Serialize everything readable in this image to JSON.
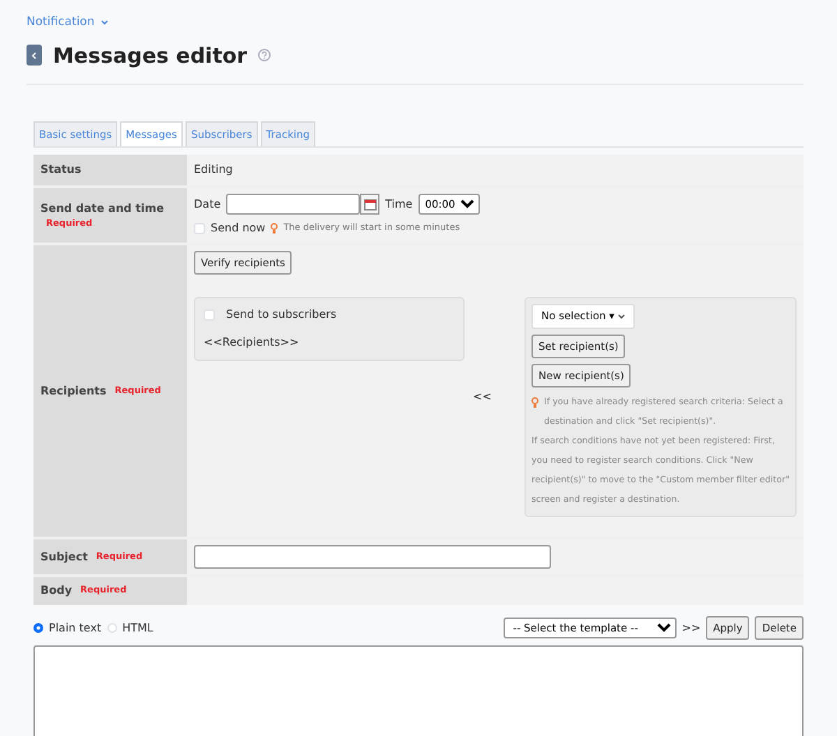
{
  "breadcrumb": {
    "label": "Notification"
  },
  "page_title": "Messages editor",
  "tabs": [
    {
      "label": "Basic settings",
      "selected": false
    },
    {
      "label": "Messages",
      "selected": true
    },
    {
      "label": "Subscribers",
      "selected": false
    },
    {
      "label": "Tracking",
      "selected": false
    }
  ],
  "form": {
    "status": {
      "label": "Status",
      "value": "Editing"
    },
    "send_date": {
      "label": "Send date and time",
      "required": "Required",
      "date_label": "Date",
      "time_label": "Time",
      "time_value": "00:00",
      "send_now": {
        "label": "Send now",
        "checked": false
      },
      "hint": "The delivery will start in some minutes"
    },
    "recipients": {
      "label": "Recipients",
      "required": "Required",
      "verify_button": "Verify recipients",
      "send_to_subscribers": {
        "label": "Send to subscribers",
        "checked": false
      },
      "recipients_placeholder": "<<Recipients>>",
      "arrow": "<<",
      "selection": "No selection ▾",
      "set_button": "Set recipient(s)",
      "new_button": "New recipient(s)",
      "help": [
        "If you have already registered search criteria: Select a destination and click \"Set recipient(s)\".",
        "If search conditions have not yet been registered: First, you need to register search conditions. Click \"New recipient(s)\" to move to the \"Custom member filter editor\" screen and register a destination."
      ]
    },
    "subject": {
      "label": "Subject",
      "required": "Required"
    },
    "body": {
      "label": "Body",
      "required": "Required"
    }
  },
  "editor": {
    "formats": [
      {
        "label": "Plain text",
        "selected": true
      },
      {
        "label": "HTML",
        "selected": false
      }
    ],
    "template": "-- Select the template --",
    "arrow": ">>",
    "apply": "Apply",
    "delete": "Delete"
  }
}
